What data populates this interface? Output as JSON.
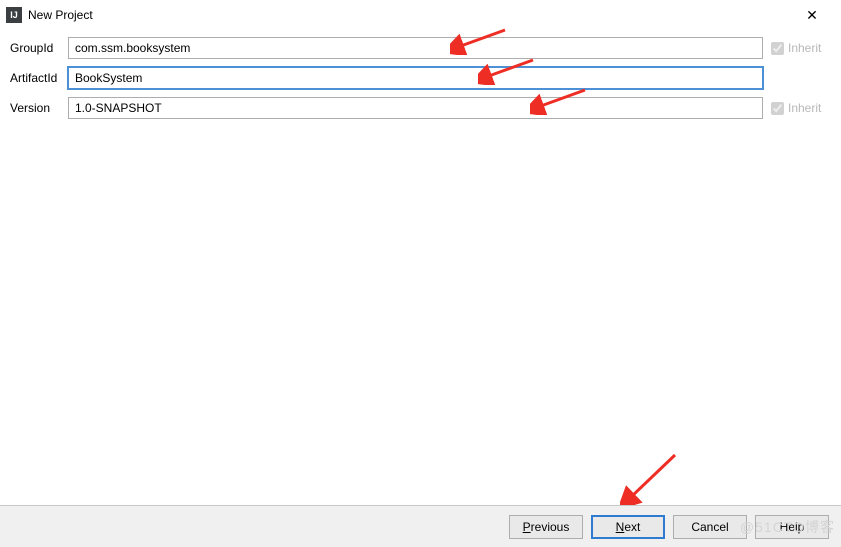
{
  "titlebar": {
    "title": "New Project",
    "close_label": "✕"
  },
  "form": {
    "groupId": {
      "label": "GroupId",
      "value": "com.ssm.booksystem",
      "inherit_label": "Inherit",
      "inherit_checked": true
    },
    "artifactId": {
      "label": "ArtifactId",
      "value": "BookSystem"
    },
    "version": {
      "label": "Version",
      "value": "1.0-SNAPSHOT",
      "inherit_label": "Inherit",
      "inherit_checked": true
    }
  },
  "buttons": {
    "previous": "Previous",
    "next": "Next",
    "cancel": "Cancel",
    "help": "Help"
  },
  "watermark": "@51CTO博客",
  "colors": {
    "accent": "#2f7bd0",
    "arrow": "#ee2d24"
  }
}
